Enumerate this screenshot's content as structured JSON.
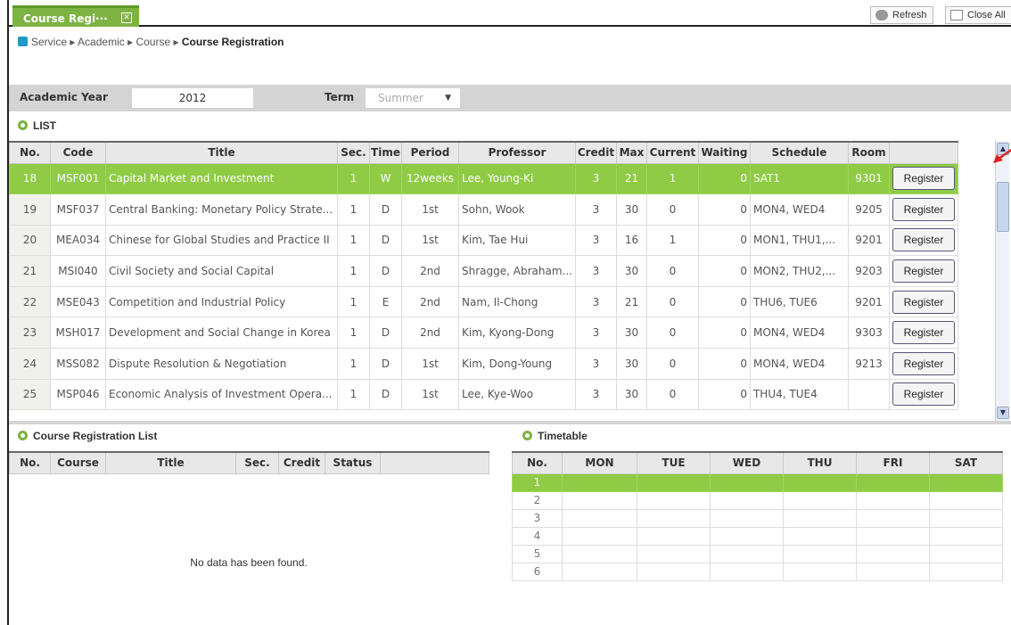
{
  "top": {
    "tab_label": "Course Regi···",
    "refresh_label": "Refresh",
    "close_all_label": "Close All"
  },
  "breadcrumb": [
    "Service",
    "Academic",
    "Course",
    "Course Registration"
  ],
  "filter": {
    "year_label": "Academic Year",
    "year_value": "2012",
    "term_label": "Term",
    "term_value": "Summer"
  },
  "list_section_title": "LIST",
  "course_table": {
    "headers": [
      "No.",
      "Code",
      "Title",
      "Sec.",
      "Time",
      "Period",
      "Professor",
      "Credit",
      "Max",
      "Current",
      "Waiting",
      "Schedule",
      "Room",
      ""
    ],
    "register_label": "Register",
    "rows": [
      {
        "no": "18",
        "code": "MSF001",
        "title": "Capital Market and Investment",
        "sec": "1",
        "time": "W",
        "period": "12weeks",
        "professor": "Lee, Young-Ki",
        "credit": "3",
        "max": "21",
        "current": "1",
        "waiting": "0",
        "schedule": "SAT1",
        "room": "9301",
        "selected": true
      },
      {
        "no": "19",
        "code": "MSF037",
        "title": "Central Banking: Monetary Policy Strate...",
        "sec": "1",
        "time": "D",
        "period": "1st",
        "professor": "Sohn, Wook",
        "credit": "3",
        "max": "30",
        "current": "0",
        "waiting": "0",
        "schedule": "MON4, WED4",
        "room": "9205",
        "selected": false
      },
      {
        "no": "20",
        "code": "MEA034",
        "title": "Chinese for Global Studies and Practice II",
        "sec": "1",
        "time": "D",
        "period": "1st",
        "professor": "Kim, Tae Hui",
        "credit": "3",
        "max": "16",
        "current": "1",
        "waiting": "0",
        "schedule": "MON1, THU1,...",
        "room": "9201",
        "selected": false
      },
      {
        "no": "21",
        "code": "MSI040",
        "title": "Civil Society and Social Capital",
        "sec": "1",
        "time": "D",
        "period": "2nd",
        "professor": "Shragge, Abraham...",
        "credit": "3",
        "max": "30",
        "current": "0",
        "waiting": "0",
        "schedule": "MON2, THU2,...",
        "room": "9203",
        "selected": false
      },
      {
        "no": "22",
        "code": "MSE043",
        "title": "Competition and Industrial Policy",
        "sec": "1",
        "time": "E",
        "period": "2nd",
        "professor": "Nam, Il-Chong",
        "credit": "3",
        "max": "21",
        "current": "0",
        "waiting": "0",
        "schedule": "THU6, TUE6",
        "room": "9201",
        "selected": false
      },
      {
        "no": "23",
        "code": "MSH017",
        "title": "Development and Social Change in Korea",
        "sec": "1",
        "time": "D",
        "period": "2nd",
        "professor": "Kim, Kyong-Dong",
        "credit": "3",
        "max": "30",
        "current": "0",
        "waiting": "0",
        "schedule": "MON4, WED4",
        "room": "9303",
        "selected": false
      },
      {
        "no": "24",
        "code": "MSS082",
        "title": "Dispute Resolution & Negotiation",
        "sec": "1",
        "time": "D",
        "period": "1st",
        "professor": "Kim, Dong-Young",
        "credit": "3",
        "max": "30",
        "current": "0",
        "waiting": "0",
        "schedule": "MON4, WED4",
        "room": "9213",
        "selected": false
      },
      {
        "no": "25",
        "code": "MSP046",
        "title": "Economic Analysis of Investment Opera...",
        "sec": "1",
        "time": "D",
        "period": "1st",
        "professor": "Lee, Kye-Woo",
        "credit": "3",
        "max": "30",
        "current": "0",
        "waiting": "0",
        "schedule": "THU4, TUE4",
        "room": "",
        "selected": false
      }
    ]
  },
  "registration": {
    "title": "Course Registration List",
    "headers": [
      "No.",
      "Course",
      "Title",
      "Sec.",
      "Credit",
      "Status",
      ""
    ],
    "empty_text": "No data has been found."
  },
  "timetable": {
    "title": "Timetable",
    "headers": [
      "No.",
      "MON",
      "TUE",
      "WED",
      "THU",
      "FRI",
      "SAT"
    ],
    "rows": [
      "1",
      "2",
      "3",
      "4",
      "5",
      "6"
    ],
    "selected_row": "1"
  },
  "colors": {
    "accent": "#7cb342",
    "selected_row": "#8fcb45",
    "annotation_arrow": "#e02020"
  }
}
